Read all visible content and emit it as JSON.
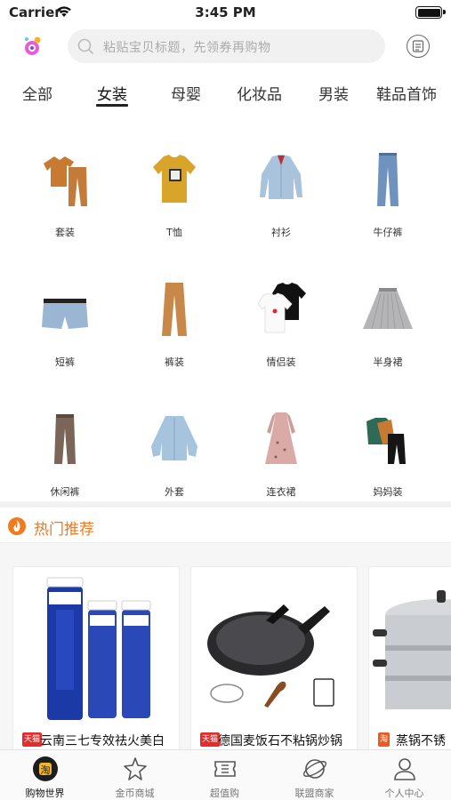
{
  "status_bar": {
    "carrier": "Carrier",
    "time": "3:45 PM"
  },
  "search": {
    "placeholder": "粘贴宝贝标题，先领券再购物"
  },
  "tabs": [
    {
      "label": "全部"
    },
    {
      "label": "女装",
      "active": true
    },
    {
      "label": "母婴"
    },
    {
      "label": "化妆品"
    },
    {
      "label": "男装"
    },
    {
      "label": "鞋品首饰"
    }
  ],
  "categories": [
    {
      "label": "套装",
      "icon": "outfit-set-icon"
    },
    {
      "label": "T恤",
      "icon": "tshirt-icon"
    },
    {
      "label": "衬衫",
      "icon": "shirt-icon"
    },
    {
      "label": "牛仔裤",
      "icon": "jeans-icon"
    },
    {
      "label": "短裤",
      "icon": "shorts-icon"
    },
    {
      "label": "裤装",
      "icon": "trousers-icon"
    },
    {
      "label": "情侣装",
      "icon": "couple-tees-icon"
    },
    {
      "label": "半身裙",
      "icon": "skirt-icon"
    },
    {
      "label": "休闲裤",
      "icon": "casual-pants-icon"
    },
    {
      "label": "外套",
      "icon": "jacket-icon"
    },
    {
      "label": "连衣裙",
      "icon": "dress-icon"
    },
    {
      "label": "妈妈装",
      "icon": "mom-wear-icon"
    }
  ],
  "hot": {
    "title": "热门推荐"
  },
  "products": [
    {
      "tag": "天猫",
      "name": "云南三七专效祛火美白",
      "image": "toothpaste-image"
    },
    {
      "tag": "天猫",
      "name": "德国麦饭石不粘锅炒锅",
      "image": "wok-image"
    },
    {
      "tag": "淘",
      "name": "蒸锅不锈",
      "image": "steamer-image"
    }
  ],
  "tabbar": [
    {
      "label": "购物世界",
      "icon": "shopping-world-icon",
      "active": true
    },
    {
      "label": "金币商城",
      "icon": "coin-mall-icon"
    },
    {
      "label": "超值购",
      "icon": "ticket-icon"
    },
    {
      "label": "联盟商家",
      "icon": "planet-icon"
    },
    {
      "label": "个人中心",
      "icon": "user-icon"
    }
  ],
  "colors": {
    "accent": "#f07a1e",
    "tmall_tag": "#e32d2d",
    "taobao_tag": "#ee5a1e"
  }
}
